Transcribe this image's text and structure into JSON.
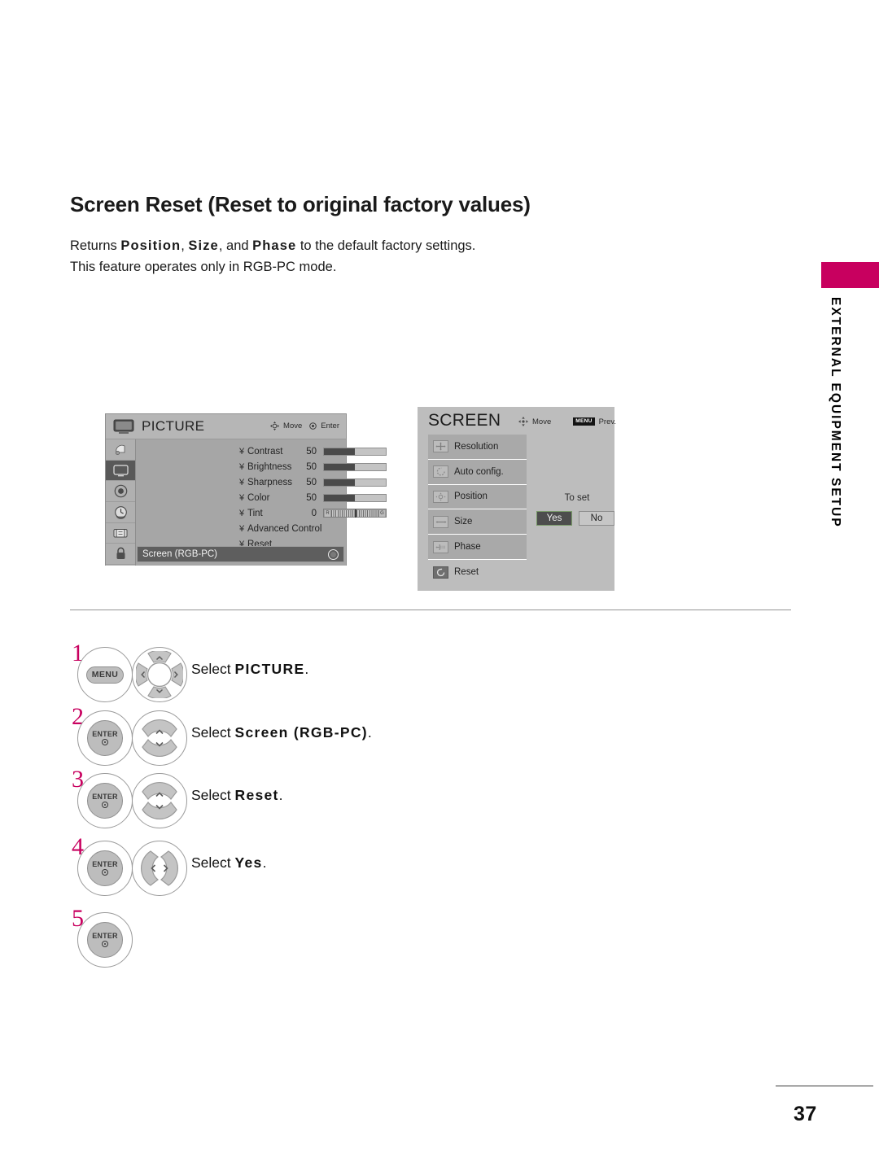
{
  "page": {
    "heading": "Screen Reset (Reset to original factory values)",
    "intro_line1_pre": "Returns ",
    "intro_b1": "Position",
    "intro_sep1": ", ",
    "intro_b2": "Size",
    "intro_sep2": ", and ",
    "intro_b3": "Phase",
    "intro_line1_post": " to the default factory settings.",
    "intro_line2": "This feature operates only in RGB-PC mode.",
    "number": "37"
  },
  "side_tab": {
    "label": "EXTERNAL EQUIPMENT SETUP",
    "color": "#c8005f"
  },
  "picture_osd": {
    "title": "PICTURE",
    "title_icon": "tv-icon",
    "hints": [
      {
        "icon": "dpad-icon",
        "label": "Move"
      },
      {
        "icon": "enter-dot-icon",
        "label": "Enter"
      }
    ],
    "sidebar_icons": [
      {
        "name": "setup-icon",
        "selected": false
      },
      {
        "name": "picture-icon",
        "selected": true
      },
      {
        "name": "audio-icon",
        "selected": false
      },
      {
        "name": "time-icon",
        "selected": false
      },
      {
        "name": "option-icon",
        "selected": false
      },
      {
        "name": "lock-icon",
        "selected": false
      }
    ],
    "rows": [
      {
        "marker": "¥",
        "label": "Contrast",
        "value": "50",
        "fill_percent": 50,
        "type": "slider"
      },
      {
        "marker": "¥",
        "label": "Brightness",
        "value": "50",
        "fill_percent": 50,
        "type": "slider"
      },
      {
        "marker": "¥",
        "label": "Sharpness",
        "value": "50",
        "fill_percent": 50,
        "type": "slider"
      },
      {
        "marker": "¥",
        "label": "Color",
        "value": "50",
        "fill_percent": 50,
        "type": "slider"
      },
      {
        "marker": "¥",
        "label": "Tint",
        "value": "0",
        "type": "tint",
        "tint_left": "R",
        "tint_right": "G"
      },
      {
        "marker": "¥",
        "label": "Advanced Control",
        "value": "",
        "type": "none"
      },
      {
        "marker": "¥",
        "label": "Reset",
        "value": "",
        "type": "none"
      }
    ],
    "selected_row": "Screen (RGB-PC)"
  },
  "screen_osd": {
    "title": "SCREEN",
    "hints": [
      {
        "icon": "dpad-icon",
        "label": "Move"
      },
      {
        "icon": "menu-badge",
        "badge": "MENU",
        "label": "Prev."
      }
    ],
    "items": [
      {
        "label": "Resolution",
        "icon": "resolution-icon",
        "highlighted": false
      },
      {
        "label": "Auto config.",
        "icon": "auto-config-icon",
        "highlighted": false
      },
      {
        "label": "Position",
        "icon": "position-icon",
        "highlighted": false
      },
      {
        "label": "Size",
        "icon": "size-icon",
        "highlighted": false
      },
      {
        "label": "Phase",
        "icon": "phase-icon",
        "highlighted": false
      },
      {
        "label": "Reset",
        "icon": "reset-icon",
        "highlighted": true
      }
    ],
    "confirm": {
      "prompt": "To set",
      "yes_label": "Yes",
      "no_label": "No",
      "selected": "Yes"
    }
  },
  "steps": [
    {
      "number": "1",
      "keys": [
        "MENU"
      ],
      "wheel": "four-way",
      "text_pre": "Select ",
      "text_bold": "PICTURE",
      "text_post": "."
    },
    {
      "number": "2",
      "keys": [
        "ENTER"
      ],
      "wheel": "up-down",
      "text_pre": "Select ",
      "text_bold": "Screen (RGB-PC)",
      "text_post": "."
    },
    {
      "number": "3",
      "keys": [
        "ENTER"
      ],
      "wheel": "up-down",
      "text_pre": "Select ",
      "text_bold": "Reset",
      "text_post": "."
    },
    {
      "number": "4",
      "keys": [
        "ENTER"
      ],
      "wheel": "left-right",
      "text_pre": "Select ",
      "text_bold": "Yes",
      "text_post": "."
    },
    {
      "number": "5",
      "keys": [
        "ENTER"
      ],
      "wheel": "none",
      "text_pre": "",
      "text_bold": "",
      "text_post": ""
    }
  ]
}
